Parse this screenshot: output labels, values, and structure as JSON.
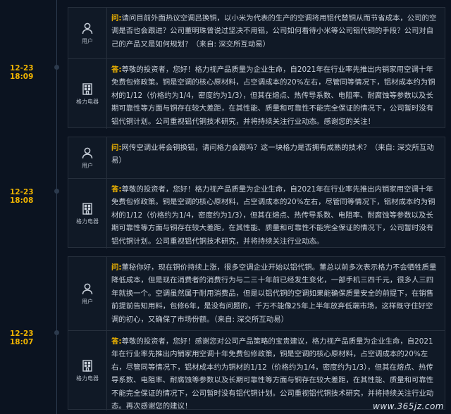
{
  "entries": [
    {
      "time": "12-23 18:09",
      "question": {
        "role": "用户",
        "tag": "问:",
        "text": "请问目前外面热议空调吕换铜，以小米为代表的生产的空调将用铝代替铜从而节省成本，公司的空调是否也会跟进？公司董明珠曾说过坚决不用铝，公司如何看待小米等公司铝代铜的手段？公司对自己的产品又是如何规划？（来自: 深交所互动易）"
      },
      "answer": {
        "role": "格力电器",
        "tag": "答:",
        "text": "尊敬的投资者，您好！格力视产品质量为企业生命，自2021年在行业率先推出内销家用空调十年免费包修政策。铜是空调的核心原材料，占空调成本的20%左右，尽管同等情况下，铝材成本约为铜材的1/12（价格约为1/4，密度约为1/3），但其在熔点、热传导系数、电阻率、耐腐蚀等参数以及长期可靠性等方面与铜存在较大差距，在其性能、质量和可靠性不能完全保证的情况下，公司暂时没有铝代铜计划。公司重视铝代铜技术研究，并将持续关注行业动态。感谢您的关注！"
      }
    },
    {
      "time": "12-23 18:08",
      "question": {
        "role": "用户",
        "tag": "问:",
        "text": "网传空调业将会铜换铝，请问格力会跟吗？这一块格力是否拥有成熟的技术？（来自: 深交所互动易）"
      },
      "answer": {
        "role": "格力电器",
        "tag": "答:",
        "text": "尊敬的投资者，您好！格力视产品质量为企业生命，自2021年在行业率先推出内销家用空调十年免费包修政策。铜是空调的核心原材料，占空调成本的20%左右，尽管同等情况下，铝材成本约为铜材的1/12（价格约为1/4，密度约为1/3），但其在熔点、热传导系数、电阻率、耐腐蚀等参数以及长期可靠性等方面与铜存在较大差距，在其性能、质量和可靠性不能完全保证的情况下，公司暂时没有铝代铜计划。公司重视铝代铜技术研究，并将持续关注行业动态。"
      }
    },
    {
      "time": "12-23 18:07",
      "question": {
        "role": "用户",
        "tag": "问:",
        "text": "董秘你好，现在铜价持续上涨，很多空调企业开始以铝代铜。董总以前多次表示格力不会牺牲质量降低成本，但是现在消费者的消费行为与二三十年前已经发生变化，一部手机三四千元，很多人三四年就换一个。空调虽然属于耐用消费品，但是以铝代铜的空调如果能确保质量安全的前提下，在销售前提前告知用料，包修6年，是没有问题的，千万不能像25年上半年放弃低端市场，这样既守住好空调的初心，又确保了市场份额。（来自: 深交所互动易）"
      },
      "answer": {
        "role": "格力电器",
        "tag": "答:",
        "text": "尊敬的投资者，您好！感谢您对公司产品策略的宝贵建议，格力视产品质量为企业生命，自2021年在行业率先推出内销家用空调十年免费包修政策，铜是空调的核心原材料，占空调成本的20%左右，尽管同等情况下，铝材成本约为铜材的1/12（价格约为1/4，密度约为1/3），但其在熔点、热传导系数、电阻率、耐腐蚀等参数以及长期可靠性等方面与铜存在较大差距，在其性能、质量和可靠性不能完全保证的情况下，公司暂时没有铝代铜计划。公司重视铝代铜技术研究，并将持续关注行业动态。再次感谢您的建议！"
      }
    }
  ],
  "watermark": "www.365jz.com",
  "colors": {
    "accent": "#f0b400",
    "background": "#0b1320",
    "card": "#101926"
  }
}
